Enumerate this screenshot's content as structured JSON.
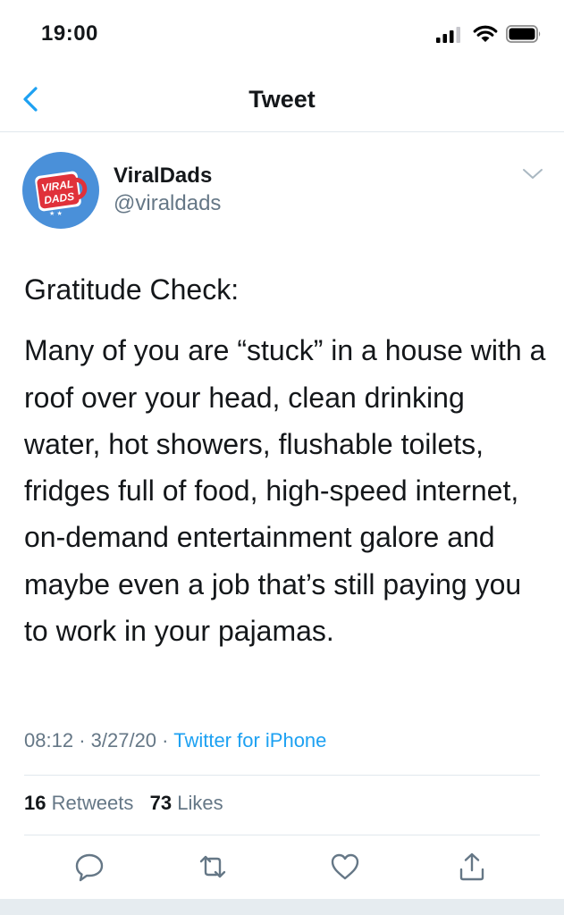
{
  "status_bar": {
    "time": "19:00",
    "icons": [
      "signal-icon",
      "wifi-icon",
      "battery-icon"
    ]
  },
  "nav": {
    "title": "Tweet",
    "back_icon": "chevron-left-icon"
  },
  "author": {
    "display_name": "ViralDads",
    "handle": "@viraldads",
    "avatar_text_line1": "VIRAL",
    "avatar_text_line2": "DADS"
  },
  "tweet": {
    "heading": "Gratitude Check:",
    "body": "Many of you are “stuck” in a house with a roof over your head, clean drinking water, hot showers, flushable toilets, fridges full of food, high-speed internet, on-demand entertainment galore and maybe even a job that’s still paying you to work in your pajamas.",
    "time": "08:12",
    "date": "3/27/20",
    "separator": "·",
    "source": "Twitter for iPhone"
  },
  "stats": {
    "retweets_count": "16",
    "retweets_label": "Retweets",
    "likes_count": "73",
    "likes_label": "Likes"
  },
  "actions": [
    "reply-icon",
    "retweet-icon",
    "like-icon",
    "share-icon"
  ],
  "colors": {
    "accent": "#1da1f2",
    "text": "#14171a",
    "muted": "#657786",
    "divider": "#e1e8ed",
    "avatar_blue": "#4a90d9",
    "avatar_red": "#e0313a"
  }
}
